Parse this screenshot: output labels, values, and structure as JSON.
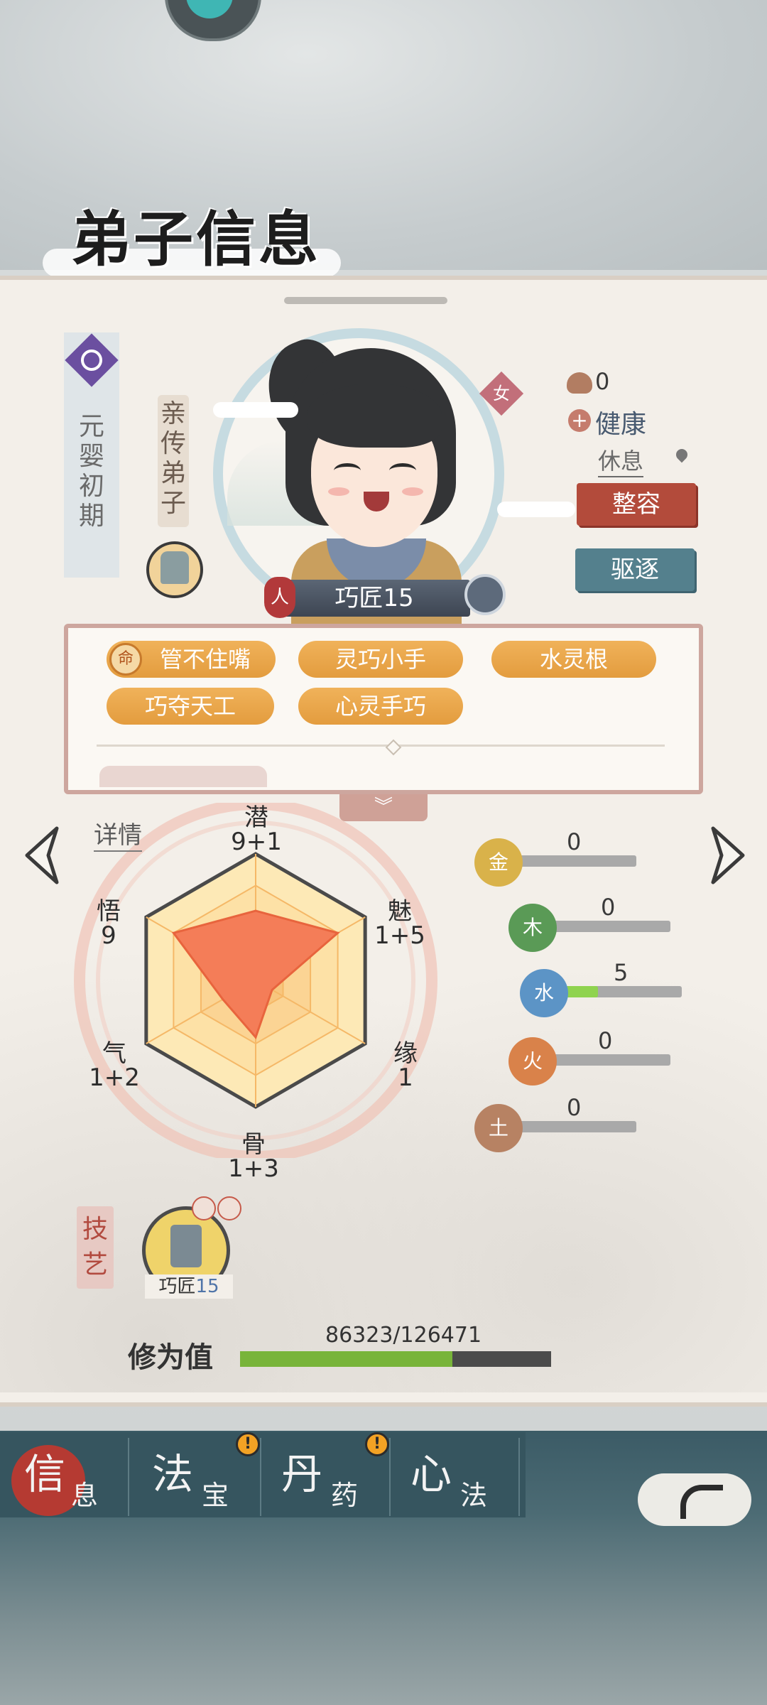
{
  "title": "弟子信息",
  "realm": {
    "label": "元婴初期",
    "icon": "realm-swirl-icon"
  },
  "rank_label": "亲传弟子",
  "gender": "女",
  "race_badge": "人",
  "role": {
    "name": "巧匠",
    "level": "15",
    "display": "巧匠15"
  },
  "status": {
    "mood_value": "0",
    "health_label": "健康",
    "activity": "休息"
  },
  "buttons": {
    "makeover": "整容",
    "expel": "驱逐"
  },
  "traits": [
    "管不住嘴",
    "灵巧小手",
    "水灵根",
    "巧夺天工",
    "心灵手巧"
  ],
  "trait_fate_icon_text": "命",
  "expand_icon": "chevron-double-down-icon",
  "details_link": "详情",
  "attributes": [
    {
      "name": "潜",
      "value": "9+1"
    },
    {
      "name": "魅",
      "value": "1+5"
    },
    {
      "name": "缘",
      "value": "1"
    },
    {
      "name": "骨",
      "value": "1+3"
    },
    {
      "name": "气",
      "value": "1+2"
    },
    {
      "name": "悟",
      "value": "9"
    }
  ],
  "radar_values": [
    0.55,
    0.75,
    0.15,
    0.45,
    0.3,
    0.75
  ],
  "elements": [
    {
      "name": "金",
      "value": "0",
      "progress": 0,
      "color": "#d9b24a"
    },
    {
      "name": "木",
      "value": "0",
      "progress": 0,
      "color": "#5a9a56"
    },
    {
      "name": "水",
      "value": "5",
      "progress": 0.4,
      "color": "#5c94c6"
    },
    {
      "name": "火",
      "value": "0",
      "progress": 0,
      "color": "#d9824a"
    },
    {
      "name": "土",
      "value": "0",
      "progress": 0,
      "color": "#b78263"
    }
  ],
  "skills_tag": "技艺",
  "skill_item": {
    "name": "巧匠",
    "level": "15"
  },
  "cultivation": {
    "label": "修为值",
    "current": 86323,
    "max": 126471,
    "display": "86323/126471"
  },
  "tabs": [
    {
      "main": "信",
      "sub": "息",
      "active": true,
      "alert": false
    },
    {
      "main": "法",
      "sub": "宝",
      "active": false,
      "alert": true
    },
    {
      "main": "丹",
      "sub": "药",
      "active": false,
      "alert": true
    },
    {
      "main": "心",
      "sub": "法",
      "active": false,
      "alert": false
    }
  ],
  "alert_glyph": "!",
  "colors": {
    "accent_red": "#b34b3b",
    "accent_teal": "#54808d",
    "trait_orange": "#e9a64a",
    "radar_fill": "#f47d58"
  }
}
